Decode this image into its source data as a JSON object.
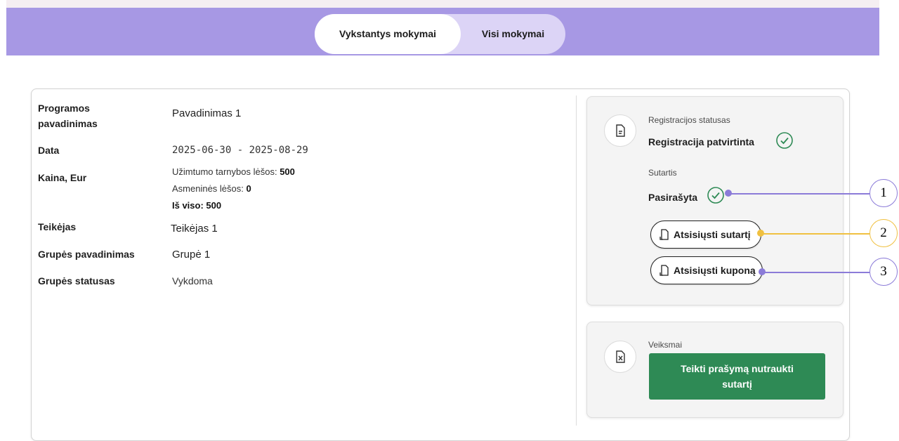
{
  "tabs": [
    {
      "label": "Vykstantys mokymai",
      "active": true
    },
    {
      "label": "Visi mokymai",
      "active": false
    }
  ],
  "details": {
    "program_label": "Programos pavadinimas",
    "program_value": "Pavadinimas 1",
    "date_label": "Data",
    "date_value": "2025-06-30 - 2025-08-29",
    "price_label": "Kaina, Eur",
    "price_lines": {
      "employment_label": "Užimtumo tarnybos lėšos:",
      "employment_value": "500",
      "personal_label": "Asmeninės lėšos:",
      "personal_value": "0",
      "total_label": "Iš viso:",
      "total_value": "500"
    },
    "provider_label": "Teikėjas",
    "provider_value": "Teikėjas 1",
    "group_name_label": "Grupės pavadinimas",
    "group_name_value": "Grupė 1",
    "group_status_label": "Grupės statusas",
    "group_status_value": "Vykdoma"
  },
  "registration_panel": {
    "status_caption": "Registracijos statusas",
    "status_value": "Registracija patvirtinta",
    "contract_caption": "Sutartis",
    "contract_value": "Pasirašyta",
    "download_contract_label": "Atsisiųsti sutartį",
    "download_coupon_label": "Atsisiųsti kuponą"
  },
  "actions_panel": {
    "caption": "Veiksmai",
    "terminate_button": "Teikti prašymą nutraukti sutartį"
  },
  "annotations": [
    {
      "number": "1",
      "color": "#8b7bd8"
    },
    {
      "number": "2",
      "color": "#f0c040"
    },
    {
      "number": "3",
      "color": "#8b7bd8"
    }
  ],
  "colors": {
    "banner": "#a798e4",
    "accent_green": "#2e8a55",
    "check_green": "#2e8a55"
  }
}
